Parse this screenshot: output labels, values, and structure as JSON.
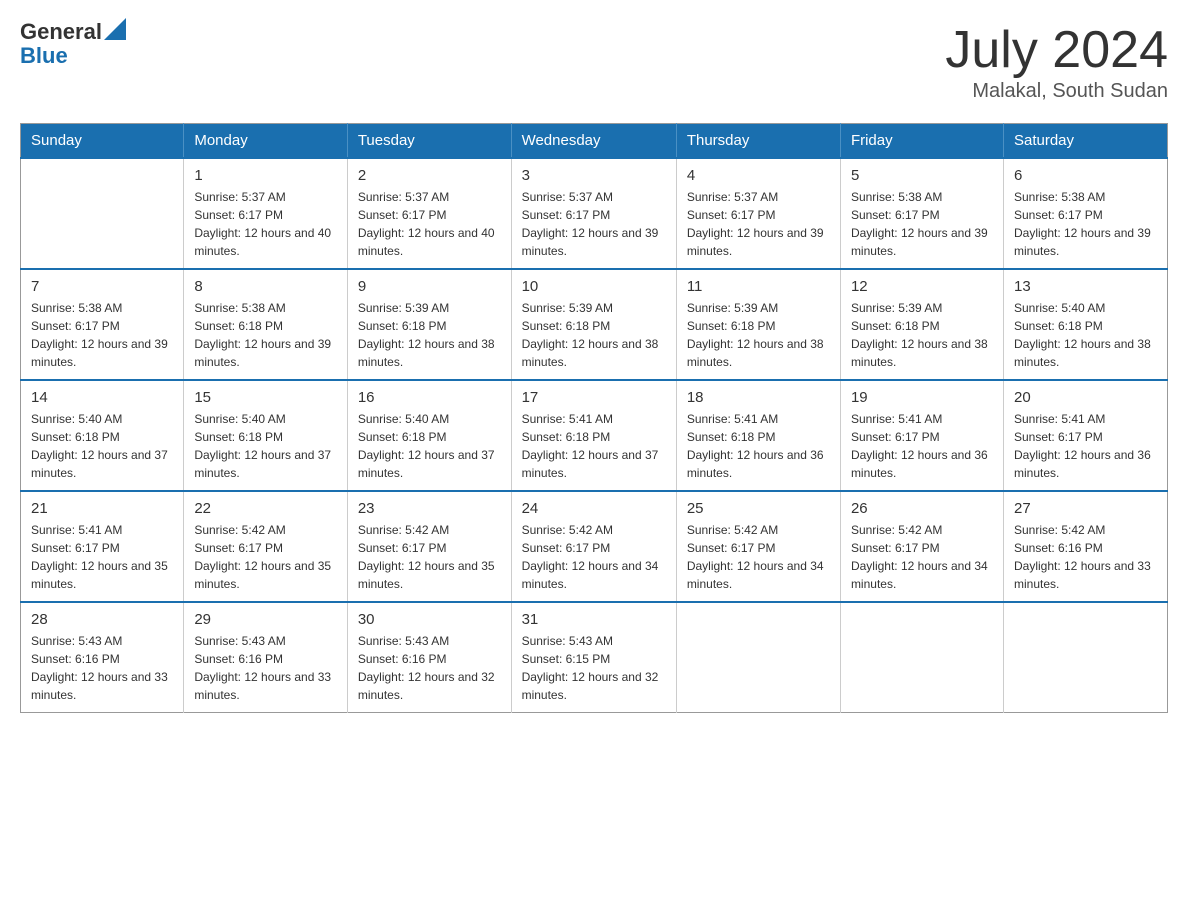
{
  "header": {
    "logo_general": "General",
    "logo_blue": "Blue",
    "month_year": "July 2024",
    "location": "Malakal, South Sudan"
  },
  "days_of_week": [
    "Sunday",
    "Monday",
    "Tuesday",
    "Wednesday",
    "Thursday",
    "Friday",
    "Saturday"
  ],
  "weeks": [
    [
      {
        "day": "",
        "sunrise": "",
        "sunset": "",
        "daylight": ""
      },
      {
        "day": "1",
        "sunrise": "Sunrise: 5:37 AM",
        "sunset": "Sunset: 6:17 PM",
        "daylight": "Daylight: 12 hours and 40 minutes."
      },
      {
        "day": "2",
        "sunrise": "Sunrise: 5:37 AM",
        "sunset": "Sunset: 6:17 PM",
        "daylight": "Daylight: 12 hours and 40 minutes."
      },
      {
        "day": "3",
        "sunrise": "Sunrise: 5:37 AM",
        "sunset": "Sunset: 6:17 PM",
        "daylight": "Daylight: 12 hours and 39 minutes."
      },
      {
        "day": "4",
        "sunrise": "Sunrise: 5:37 AM",
        "sunset": "Sunset: 6:17 PM",
        "daylight": "Daylight: 12 hours and 39 minutes."
      },
      {
        "day": "5",
        "sunrise": "Sunrise: 5:38 AM",
        "sunset": "Sunset: 6:17 PM",
        "daylight": "Daylight: 12 hours and 39 minutes."
      },
      {
        "day": "6",
        "sunrise": "Sunrise: 5:38 AM",
        "sunset": "Sunset: 6:17 PM",
        "daylight": "Daylight: 12 hours and 39 minutes."
      }
    ],
    [
      {
        "day": "7",
        "sunrise": "Sunrise: 5:38 AM",
        "sunset": "Sunset: 6:17 PM",
        "daylight": "Daylight: 12 hours and 39 minutes."
      },
      {
        "day": "8",
        "sunrise": "Sunrise: 5:38 AM",
        "sunset": "Sunset: 6:18 PM",
        "daylight": "Daylight: 12 hours and 39 minutes."
      },
      {
        "day": "9",
        "sunrise": "Sunrise: 5:39 AM",
        "sunset": "Sunset: 6:18 PM",
        "daylight": "Daylight: 12 hours and 38 minutes."
      },
      {
        "day": "10",
        "sunrise": "Sunrise: 5:39 AM",
        "sunset": "Sunset: 6:18 PM",
        "daylight": "Daylight: 12 hours and 38 minutes."
      },
      {
        "day": "11",
        "sunrise": "Sunrise: 5:39 AM",
        "sunset": "Sunset: 6:18 PM",
        "daylight": "Daylight: 12 hours and 38 minutes."
      },
      {
        "day": "12",
        "sunrise": "Sunrise: 5:39 AM",
        "sunset": "Sunset: 6:18 PM",
        "daylight": "Daylight: 12 hours and 38 minutes."
      },
      {
        "day": "13",
        "sunrise": "Sunrise: 5:40 AM",
        "sunset": "Sunset: 6:18 PM",
        "daylight": "Daylight: 12 hours and 38 minutes."
      }
    ],
    [
      {
        "day": "14",
        "sunrise": "Sunrise: 5:40 AM",
        "sunset": "Sunset: 6:18 PM",
        "daylight": "Daylight: 12 hours and 37 minutes."
      },
      {
        "day": "15",
        "sunrise": "Sunrise: 5:40 AM",
        "sunset": "Sunset: 6:18 PM",
        "daylight": "Daylight: 12 hours and 37 minutes."
      },
      {
        "day": "16",
        "sunrise": "Sunrise: 5:40 AM",
        "sunset": "Sunset: 6:18 PM",
        "daylight": "Daylight: 12 hours and 37 minutes."
      },
      {
        "day": "17",
        "sunrise": "Sunrise: 5:41 AM",
        "sunset": "Sunset: 6:18 PM",
        "daylight": "Daylight: 12 hours and 37 minutes."
      },
      {
        "day": "18",
        "sunrise": "Sunrise: 5:41 AM",
        "sunset": "Sunset: 6:18 PM",
        "daylight": "Daylight: 12 hours and 36 minutes."
      },
      {
        "day": "19",
        "sunrise": "Sunrise: 5:41 AM",
        "sunset": "Sunset: 6:17 PM",
        "daylight": "Daylight: 12 hours and 36 minutes."
      },
      {
        "day": "20",
        "sunrise": "Sunrise: 5:41 AM",
        "sunset": "Sunset: 6:17 PM",
        "daylight": "Daylight: 12 hours and 36 minutes."
      }
    ],
    [
      {
        "day": "21",
        "sunrise": "Sunrise: 5:41 AM",
        "sunset": "Sunset: 6:17 PM",
        "daylight": "Daylight: 12 hours and 35 minutes."
      },
      {
        "day": "22",
        "sunrise": "Sunrise: 5:42 AM",
        "sunset": "Sunset: 6:17 PM",
        "daylight": "Daylight: 12 hours and 35 minutes."
      },
      {
        "day": "23",
        "sunrise": "Sunrise: 5:42 AM",
        "sunset": "Sunset: 6:17 PM",
        "daylight": "Daylight: 12 hours and 35 minutes."
      },
      {
        "day": "24",
        "sunrise": "Sunrise: 5:42 AM",
        "sunset": "Sunset: 6:17 PM",
        "daylight": "Daylight: 12 hours and 34 minutes."
      },
      {
        "day": "25",
        "sunrise": "Sunrise: 5:42 AM",
        "sunset": "Sunset: 6:17 PM",
        "daylight": "Daylight: 12 hours and 34 minutes."
      },
      {
        "day": "26",
        "sunrise": "Sunrise: 5:42 AM",
        "sunset": "Sunset: 6:17 PM",
        "daylight": "Daylight: 12 hours and 34 minutes."
      },
      {
        "day": "27",
        "sunrise": "Sunrise: 5:42 AM",
        "sunset": "Sunset: 6:16 PM",
        "daylight": "Daylight: 12 hours and 33 minutes."
      }
    ],
    [
      {
        "day": "28",
        "sunrise": "Sunrise: 5:43 AM",
        "sunset": "Sunset: 6:16 PM",
        "daylight": "Daylight: 12 hours and 33 minutes."
      },
      {
        "day": "29",
        "sunrise": "Sunrise: 5:43 AM",
        "sunset": "Sunset: 6:16 PM",
        "daylight": "Daylight: 12 hours and 33 minutes."
      },
      {
        "day": "30",
        "sunrise": "Sunrise: 5:43 AM",
        "sunset": "Sunset: 6:16 PM",
        "daylight": "Daylight: 12 hours and 32 minutes."
      },
      {
        "day": "31",
        "sunrise": "Sunrise: 5:43 AM",
        "sunset": "Sunset: 6:15 PM",
        "daylight": "Daylight: 12 hours and 32 minutes."
      },
      {
        "day": "",
        "sunrise": "",
        "sunset": "",
        "daylight": ""
      },
      {
        "day": "",
        "sunrise": "",
        "sunset": "",
        "daylight": ""
      },
      {
        "day": "",
        "sunrise": "",
        "sunset": "",
        "daylight": ""
      }
    ]
  ]
}
